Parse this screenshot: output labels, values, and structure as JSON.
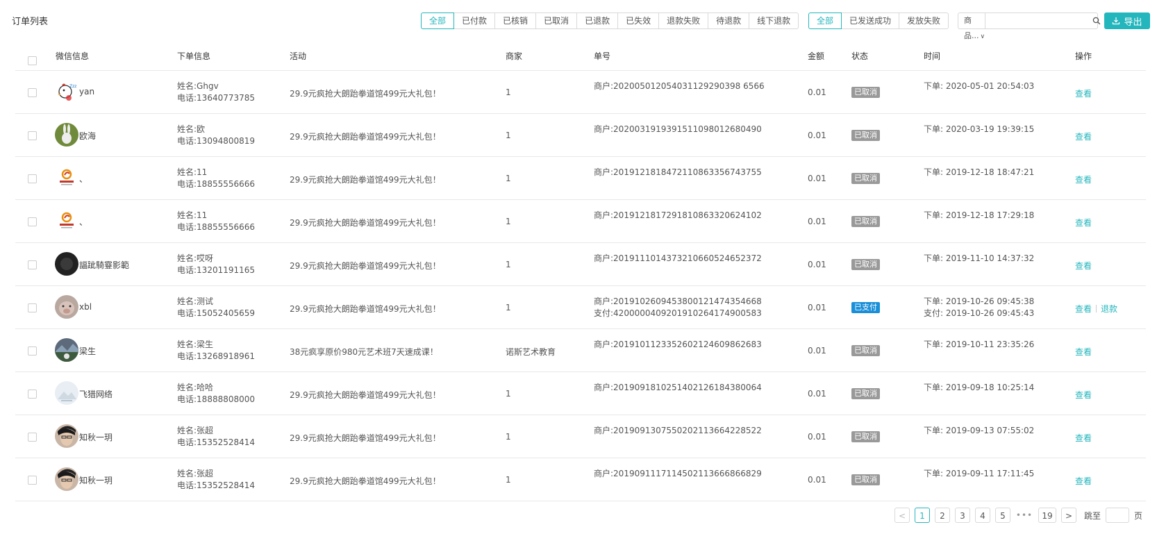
{
  "header": {
    "title": "订单列表"
  },
  "status_filters": [
    "全部",
    "已付款",
    "已核销",
    "已取消",
    "已退款",
    "已失效",
    "退款失败",
    "待退款",
    "线下退款"
  ],
  "send_filters": [
    "全部",
    "已发送成功",
    "发放失败"
  ],
  "search": {
    "select_label": "商品...",
    "chevron": "∨",
    "input_value": "",
    "placeholder": ""
  },
  "export": {
    "label": "导出",
    "icon": "download-icon"
  },
  "columns": [
    "微信信息",
    "下单信息",
    "活动",
    "商家",
    "单号",
    "金额",
    "状态",
    "时间",
    "操作"
  ],
  "orders": [
    {
      "wx_name": "yan",
      "avatar": "chicken",
      "name_line": "姓名:Ghgv",
      "phone_line": "电话:13640773785",
      "activity": "29.9元疯抢大朗跆拳道馆499元大礼包！",
      "merchant": "1",
      "order_line1": "商户:202005012054031129290398 6566",
      "order_line2": "",
      "amount": "0.01",
      "status": "已取消",
      "time_line1": "下单: 2020-05-01 20:54:03",
      "time_line2": "",
      "ops": [
        "查看"
      ]
    },
    {
      "wx_name": "欧海",
      "avatar": "rabbit",
      "name_line": "姓名:欧",
      "phone_line": "电话:13094800819",
      "activity": "29.9元疯抢大朗跆拳道馆499元大礼包！",
      "merchant": "1",
      "order_line1": "商户:2020031919391511098012680490",
      "order_line2": "",
      "amount": "0.01",
      "status": "已取消",
      "time_line1": "下单: 2020-03-19 19:39:15",
      "time_line2": "",
      "ops": [
        "查看"
      ]
    },
    {
      "wx_name": "、",
      "avatar": "logo",
      "name_line": "姓名:11",
      "phone_line": "电话:18855556666",
      "activity": "29.9元疯抢大朗跆拳道馆499元大礼包！",
      "merchant": "1",
      "order_line1": "商户:2019121818472110863356743755",
      "order_line2": "",
      "amount": "0.01",
      "status": "已取消",
      "time_line1": "下单: 2019-12-18 18:47:21",
      "time_line2": "",
      "ops": [
        "查看"
      ]
    },
    {
      "wx_name": "、",
      "avatar": "logo",
      "name_line": "姓名:11",
      "phone_line": "电话:18855556666",
      "activity": "29.9元疯抢大朗跆拳道馆499元大礼包！",
      "merchant": "1",
      "order_line1": "商户:2019121817291810863320624102",
      "order_line2": "",
      "amount": "0.01",
      "status": "已取消",
      "time_line1": "下单: 2019-12-18 17:29:18",
      "time_line2": "",
      "ops": [
        "查看"
      ]
    },
    {
      "wx_name": "諨跐騎霯影範",
      "avatar": "dark",
      "name_line": "姓名:哎呀",
      "phone_line": "电话:13201191165",
      "activity": "29.9元疯抢大朗跆拳道馆499元大礼包！",
      "merchant": "1",
      "order_line1": "商户:2019111014373210660524652372",
      "order_line2": "",
      "amount": "0.01",
      "status": "已取消",
      "time_line1": "下单: 2019-11-10 14:37:32",
      "time_line2": "",
      "ops": [
        "查看"
      ]
    },
    {
      "wx_name": "xbl",
      "avatar": "pig",
      "name_line": "姓名:测试",
      "phone_line": "电话:15052405659",
      "activity": "29.9元疯抢大朗跆拳道馆499元大礼包！",
      "merchant": "1",
      "order_line1": "商户:2019102609453800121474354668",
      "order_line2": "支付:4200000409201910264174900583",
      "amount": "0.01",
      "status": "已支付",
      "time_line1": "下单: 2019-10-26 09:45:38",
      "time_line2": "支付: 2019-10-26 09:45:43",
      "ops": [
        "查看",
        "退款"
      ]
    },
    {
      "wx_name": "梁生",
      "avatar": "landscape",
      "name_line": "姓名:梁生",
      "phone_line": "电话:13268918961",
      "activity": "38元疯享原价980元艺术班7天速成课！",
      "merchant": "诺斯艺术教育",
      "order_line1": "商户:2019101123352602124609862683",
      "order_line2": "",
      "amount": "0.01",
      "status": "已取消",
      "time_line1": "下单: 2019-10-11 23:35:26",
      "time_line2": "",
      "ops": [
        "查看"
      ]
    },
    {
      "wx_name": "飞猎网络",
      "avatar": "light",
      "name_line": "姓名:哈哈",
      "phone_line": "电话:18888808000",
      "activity": "29.9元疯抢大朗跆拳道馆499元大礼包！",
      "merchant": "1",
      "order_line1": "商户:2019091810251402126184380064",
      "order_line2": "",
      "amount": "0.01",
      "status": "已取消",
      "time_line1": "下单: 2019-09-18 10:25:14",
      "time_line2": "",
      "ops": [
        "查看"
      ]
    },
    {
      "wx_name": "知秋一玥",
      "avatar": "face",
      "name_line": "姓名:张超",
      "phone_line": "电话:15352528414",
      "activity": "29.9元疯抢大朗跆拳道馆499元大礼包！",
      "merchant": "1",
      "order_line1": "商户:2019091307550202113664228522",
      "order_line2": "",
      "amount": "0.01",
      "status": "已取消",
      "time_line1": "下单: 2019-09-13 07:55:02",
      "time_line2": "",
      "ops": [
        "查看"
      ]
    },
    {
      "wx_name": "知秋一玥",
      "avatar": "face",
      "name_line": "姓名:张超",
      "phone_line": "电话:15352528414",
      "activity": "29.9元疯抢大朗跆拳道馆499元大礼包！",
      "merchant": "1",
      "order_line1": "商户:2019091117114502113666866829",
      "order_line2": "",
      "amount": "0.01",
      "status": "已取消",
      "time_line1": "下单: 2019-09-11 17:11:45",
      "time_line2": "",
      "ops": [
        "查看"
      ]
    }
  ],
  "pagination": {
    "prev": "<",
    "next": ">",
    "pages": [
      "1",
      "2",
      "3",
      "4",
      "5"
    ],
    "ellipsis": "•••",
    "last": "19",
    "current": "1",
    "jump_label": "跳至",
    "jump_value": "",
    "unit": "页"
  },
  "colors": {
    "accent": "#24b6bd",
    "status_cancelled": "#999999",
    "status_paid": "#1a8fd8"
  }
}
